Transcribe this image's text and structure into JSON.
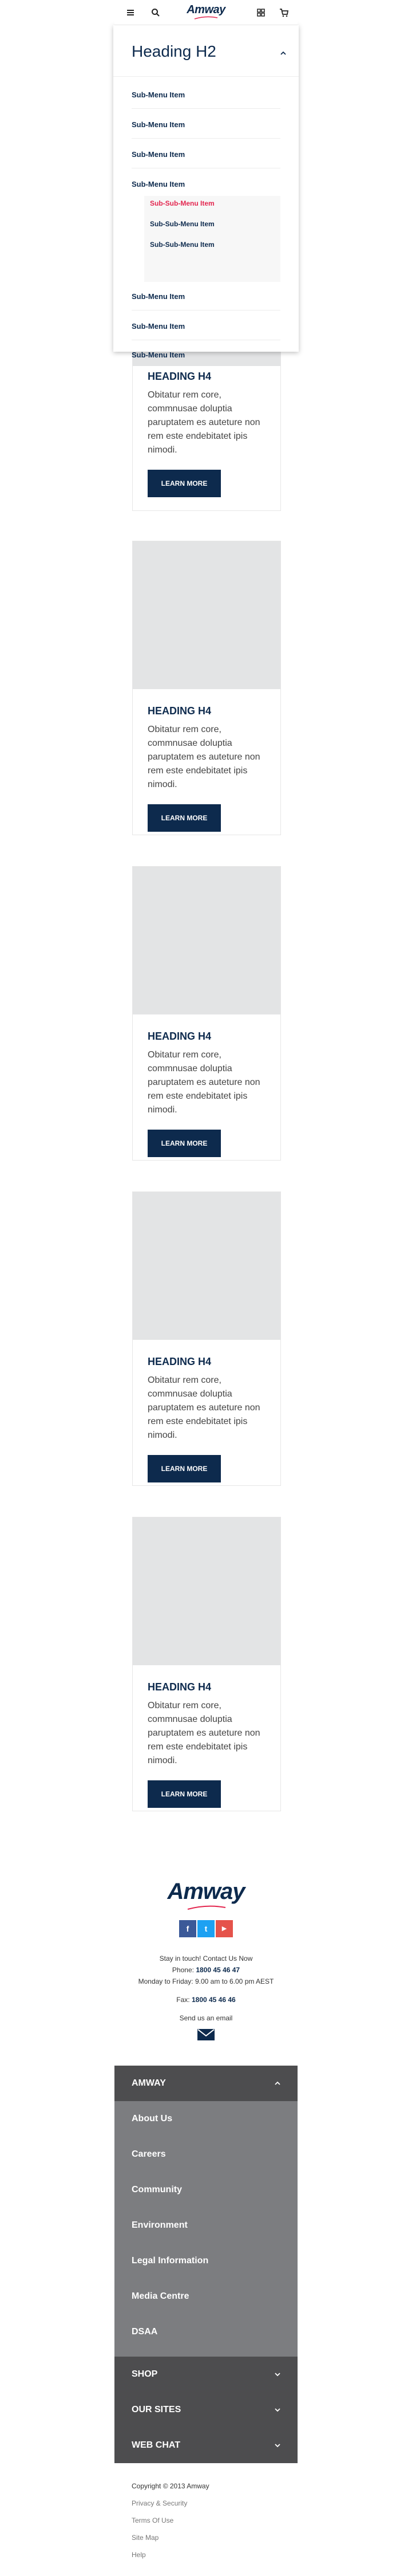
{
  "header": {
    "logo_text": "Amway",
    "icons": [
      "menu-icon",
      "search-icon",
      "grid-icon",
      "cart-icon"
    ]
  },
  "menu": {
    "title": "Heading H2",
    "items_top": [
      "Sub-Menu Item",
      "Sub-Menu Item",
      "Sub-Menu Item",
      "Sub-Menu Item"
    ],
    "sub_items": [
      "Sub-Sub-Menu Item",
      "Sub-Sub-Menu Item",
      "Sub-Sub-Menu Item"
    ],
    "items_bottom": [
      "Sub-Menu Item",
      "Sub-Menu Item",
      "Sub-Menu Item"
    ],
    "active_color": "#e3264f"
  },
  "cards": [
    {
      "heading": "HEADING H4",
      "text": "Obitatur rem core, commnusae doluptia paruptatem es auteture non rem este endebitatet ipis nimodi.",
      "button": "LEARN MORE"
    },
    {
      "heading": "HEADING H4",
      "text": "Obitatur rem core, commnusae doluptia paruptatem es auteture non rem este endebitatet ipis nimodi.",
      "button": "LEARN MORE"
    },
    {
      "heading": "HEADING H4",
      "text": "Obitatur rem core, commnusae doluptia paruptatem es auteture non rem este endebitatet ipis nimodi.",
      "button": "LEARN MORE"
    },
    {
      "heading": "HEADING H4",
      "text": "Obitatur rem core, commnusae doluptia paruptatem es auteture non rem este endebitatet ipis nimodi.",
      "button": "LEARN MORE"
    },
    {
      "heading": "HEADING H4",
      "text": "Obitatur rem core, commnusae doluptia paruptatem es auteture non rem este endebitatet ipis nimodi.",
      "button": "LEARN MORE"
    }
  ],
  "footer": {
    "logo_text": "Amway",
    "social": [
      {
        "name": "facebook-icon",
        "glyph": "f",
        "color": "#3b5998"
      },
      {
        "name": "twitter-icon",
        "glyph": "t",
        "color": "#1da1f2"
      },
      {
        "name": "youtube-icon",
        "glyph": "▶",
        "color": "#e5534b"
      }
    ],
    "stay_in_touch": "Stay in touch! Contact Us Now",
    "phone_label": "Phone:",
    "phone": "1800 45 46 47",
    "hours": "Monday to Friday: 9.00 am to 6.00 pm AEST",
    "fax_label": "Fax:",
    "fax": "1800 45 46 46",
    "email_label": "Send us an email",
    "accordion": {
      "amway": "AMWAY",
      "amway_links": [
        "About Us",
        "Careers",
        "Community",
        "Environment",
        "Legal Information",
        "Media Centre",
        "DSAA"
      ],
      "shop": "SHOP",
      "our_sites": "OUR SITES",
      "web_chat": "WEB CHAT"
    },
    "copyright": "Copyright © 2013 Amway",
    "links": [
      "Privacy & Security",
      "Terms Of Use",
      "Site Map",
      "Help"
    ]
  }
}
